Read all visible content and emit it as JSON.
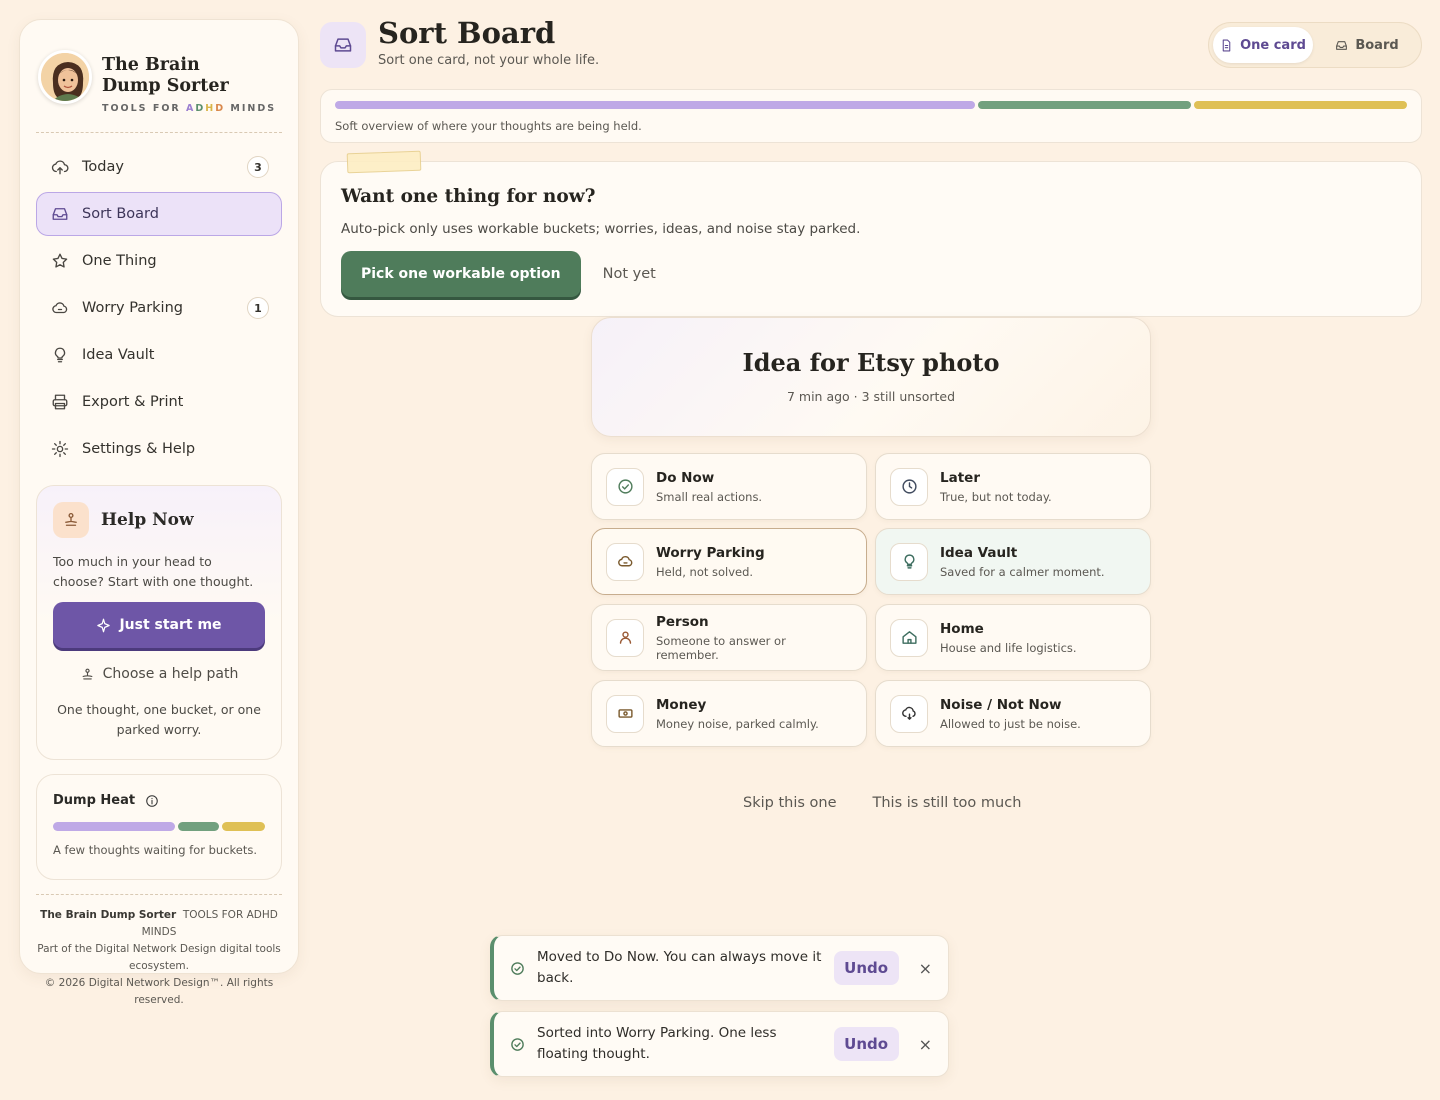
{
  "brand": {
    "title_line1": "The Brain",
    "title_line2": "Dump Sorter",
    "sub_prefix": "TOOLS FOR ",
    "sub_a": "A",
    "sub_d1": "D",
    "sub_h": "H",
    "sub_d2": "D",
    "sub_suffix": " MINDS"
  },
  "nav": [
    {
      "label": "Today",
      "badge": "3",
      "icon": "cloud-upload-icon"
    },
    {
      "label": "Sort Board",
      "badge": "",
      "icon": "inbox-icon"
    },
    {
      "label": "One Thing",
      "badge": "",
      "icon": "star-icon"
    },
    {
      "label": "Worry Parking",
      "badge": "1",
      "icon": "cloud-icon"
    },
    {
      "label": "Idea Vault",
      "badge": "",
      "icon": "lightbulb-icon"
    },
    {
      "label": "Export & Print",
      "badge": "",
      "icon": "printer-icon"
    },
    {
      "label": "Settings & Help",
      "badge": "",
      "icon": "sun-gear-icon"
    }
  ],
  "help": {
    "title": "Help Now",
    "text": "Too much in your head to choose? Start with one thought.",
    "primary": "Just start me",
    "secondary": "Choose a help path",
    "footer": "One thought, one bucket, or one parked worry."
  },
  "heat": {
    "title": "Dump Heat",
    "text": "A few thoughts waiting for buckets.",
    "segments": [
      {
        "color": "#bfa9e6",
        "weight": 0.59
      },
      {
        "color": "#72a07e",
        "weight": 0.2
      },
      {
        "color": "#dfc055",
        "weight": 0.21
      }
    ]
  },
  "footer": {
    "line1_bold": "The Brain Dump Sorter",
    "line1_rest": "TOOLS FOR ADHD MINDS",
    "line2": "Part of the Digital Network Design digital tools ecosystem.",
    "line3": "© 2026 Digital Network Design™. All rights reserved."
  },
  "header": {
    "title": "Sort Board",
    "subtitle": "Sort one card, not your whole life."
  },
  "view_toggle": {
    "one_card": "One card",
    "board": "Board",
    "selected": "One card"
  },
  "overview": {
    "text": "Soft overview of where your thoughts are being held.",
    "segments": [
      {
        "color": "#bfa9e6",
        "weight": 0.6
      },
      {
        "color": "#72a07e",
        "weight": 0.2
      },
      {
        "color": "#dfc055",
        "weight": 0.2
      }
    ]
  },
  "focus": {
    "title": "Want one thing for now?",
    "text": "Auto-pick only uses workable buckets; worries, ideas, and noise stay parked.",
    "primary": "Pick one workable option",
    "secondary": "Not yet"
  },
  "card": {
    "title": "Idea for Etsy photo",
    "meta": "7 min ago · 3 still unsorted"
  },
  "buckets": [
    {
      "name": "Do Now",
      "desc": "Small real actions.",
      "icon": "check-circle-icon"
    },
    {
      "name": "Later",
      "desc": "True, but not today.",
      "icon": "clock-icon"
    },
    {
      "name": "Worry Parking",
      "desc": "Held, not solved.",
      "icon": "cloud-icon"
    },
    {
      "name": "Idea Vault",
      "desc": "Saved for a calmer moment.",
      "icon": "lightbulb-icon"
    },
    {
      "name": "Person",
      "desc": "Someone to answer or remember.",
      "icon": "person-icon"
    },
    {
      "name": "Home",
      "desc": "House and life logistics.",
      "icon": "home-icon"
    },
    {
      "name": "Money",
      "desc": "Money noise, parked calmly.",
      "icon": "banknote-icon"
    },
    {
      "name": "Noise / Not Now",
      "desc": "Allowed to just be noise.",
      "icon": "wind-icon"
    }
  ],
  "skip": {
    "skip": "Skip this one",
    "too_much": "This is still too much"
  },
  "toasts": [
    {
      "message": "Moved to Do Now. You can always move it back.",
      "undo": "Undo",
      "close": "×"
    },
    {
      "message": "Sorted into Worry Parking. One less floating thought.",
      "undo": "Undo",
      "close": "×"
    }
  ],
  "colors": {
    "accent": "#6e56a7",
    "green": "#4f7c5b",
    "background": "#fdf1e3"
  }
}
